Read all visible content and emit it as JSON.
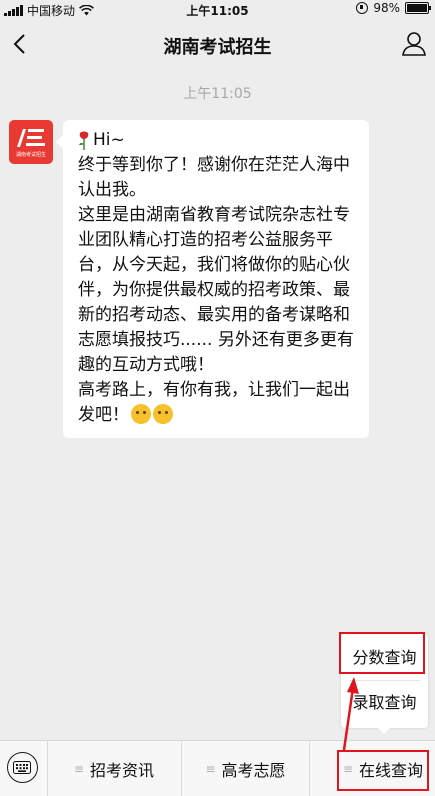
{
  "status_bar": {
    "carrier": "中国移动",
    "time": "上午11:05",
    "battery": "98%",
    "battery_level": 0.98
  },
  "nav": {
    "title": "湖南考试招生",
    "back_icon": "chevron-left-icon",
    "profile_icon": "person-icon"
  },
  "chat": {
    "timestamp": "上午11:05",
    "avatar_text": "湖南考试招生",
    "message": {
      "greeting": "Hi~",
      "line1": "终于等到你了！感谢你在茫茫人海中认出我。",
      "line2": "这里是由湖南省教育考试院杂志社专业团队精心打造的招考公益服务平台，从今天起，我们将做你的贴心伙伴，为你提供最权威的招考政策、最新的招考动态、最实用的备考谋略和志愿填报技巧...... 另外还有更多更有趣的互动方式哦！",
      "line3": "高考路上，有你有我，让我们一起出发吧！"
    }
  },
  "popup_menu": {
    "items": [
      "分数查询",
      "录取查询"
    ]
  },
  "bottom_menu": {
    "items": [
      "招考资讯",
      "高考志愿",
      "在线查询"
    ]
  },
  "colors": {
    "highlight": "#e0141e",
    "avatar_bg": "#e83a32",
    "background": "#ededed"
  }
}
